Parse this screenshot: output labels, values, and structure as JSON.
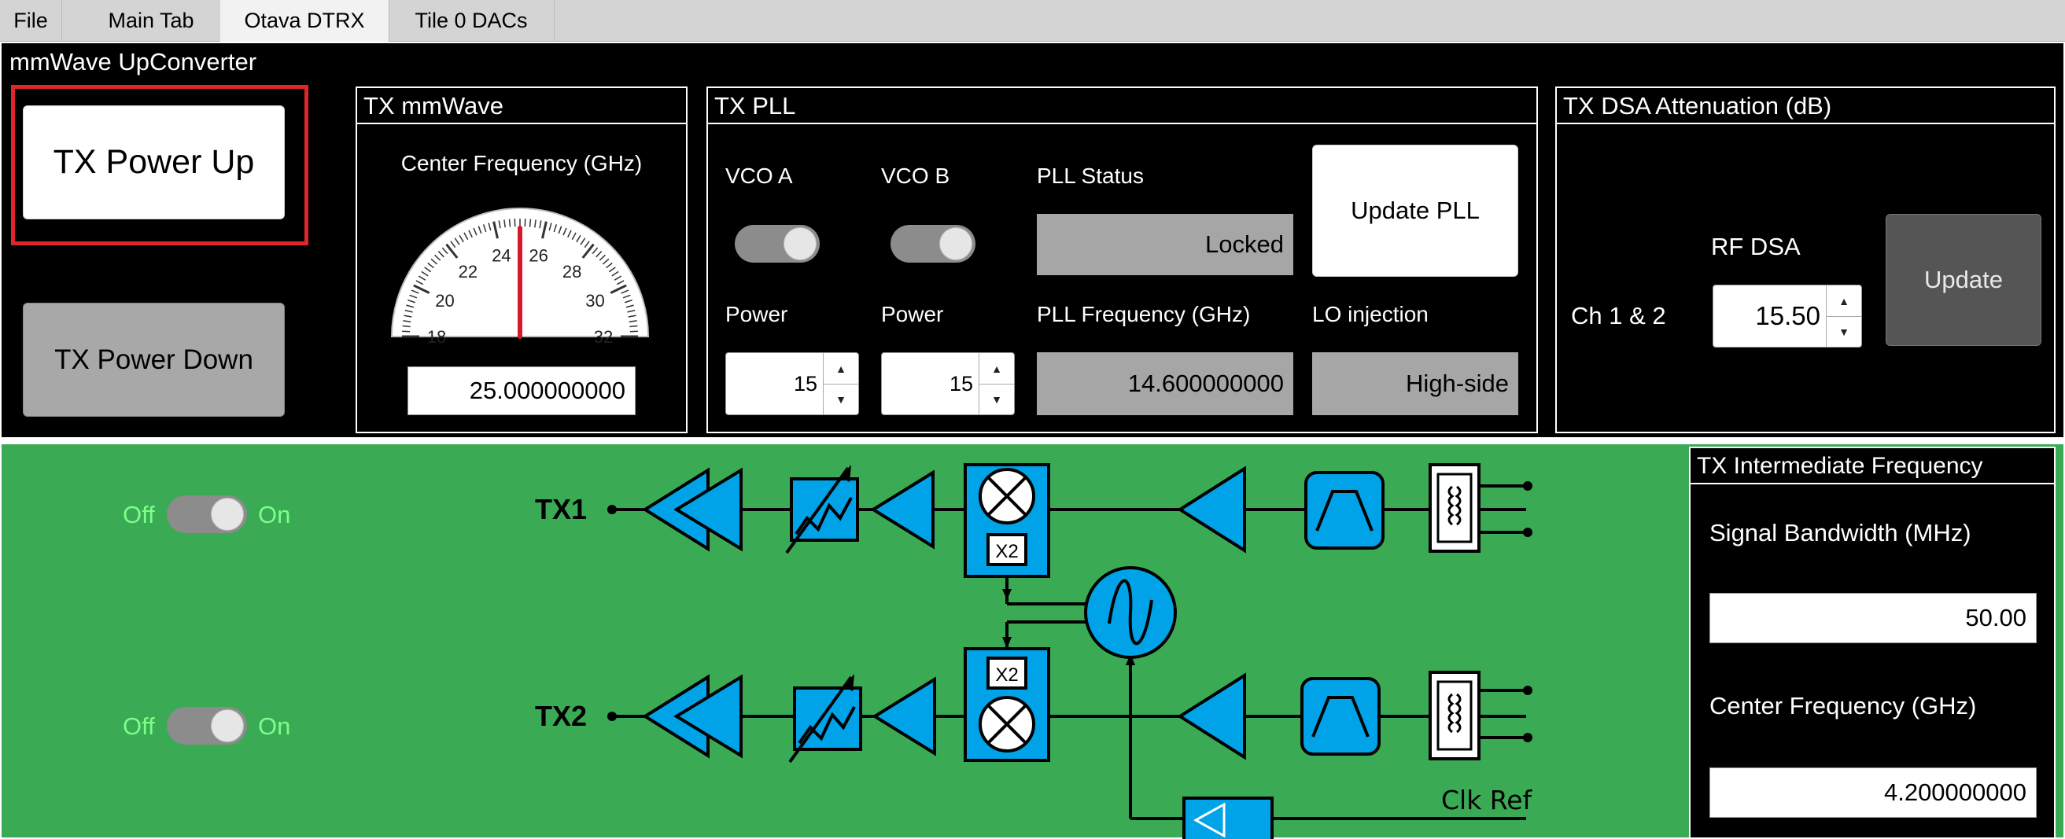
{
  "tabs": [
    {
      "label": "File"
    },
    {
      "label": "Main Tab"
    },
    {
      "label": "Otava DTRX"
    },
    {
      "label": "Tile 0 DACs"
    }
  ],
  "panel": {
    "title": "mmWave UpConverter",
    "power_up_label": "TX Power Up",
    "power_down_label": "TX Power Down",
    "highlight_color": "#e0262a"
  },
  "tx_mmwave": {
    "title": "TX mmWave",
    "gauge_label": "Center Frequency (GHz)",
    "gauge_ticks": [
      "18",
      "20",
      "22",
      "24",
      "26",
      "28",
      "30",
      "32"
    ],
    "gauge_value": 25.0,
    "gauge_min": 18,
    "gauge_max": 32,
    "frequency_value": "25.000000000"
  },
  "tx_pll": {
    "title": "TX PLL",
    "vco_a_label": "VCO A",
    "vco_b_label": "VCO B",
    "pll_status_label": "PLL Status",
    "pll_status_value": "Locked",
    "update_pll_label": "Update PLL",
    "power_a_label": "Power",
    "power_b_label": "Power",
    "power_a_value": "15",
    "power_b_value": "15",
    "pll_freq_label": "PLL Frequency (GHz)",
    "pll_freq_value": "14.600000000",
    "lo_injection_label": "LO injection",
    "lo_injection_value": "High-side"
  },
  "tx_dsa": {
    "title": "TX DSA Attenuation (dB)",
    "rf_dsa_label": "RF DSA",
    "channel_label": "Ch 1 & 2",
    "rf_dsa_value": "15.50",
    "update_label": "Update"
  },
  "diagram": {
    "tx1_label": "TX1",
    "tx2_label": "TX2",
    "toggle_off": "Off",
    "toggle_on": "On",
    "x2_label": "X2",
    "clk_ref_label": "Clk Ref",
    "block_color": "#00a2e8"
  },
  "tx_if": {
    "title": "TX Intermediate Frequency",
    "bandwidth_label": "Signal Bandwidth (MHz)",
    "bandwidth_value": "50.00",
    "center_freq_label": "Center Frequency (GHz)",
    "center_freq_value": "4.200000000"
  }
}
